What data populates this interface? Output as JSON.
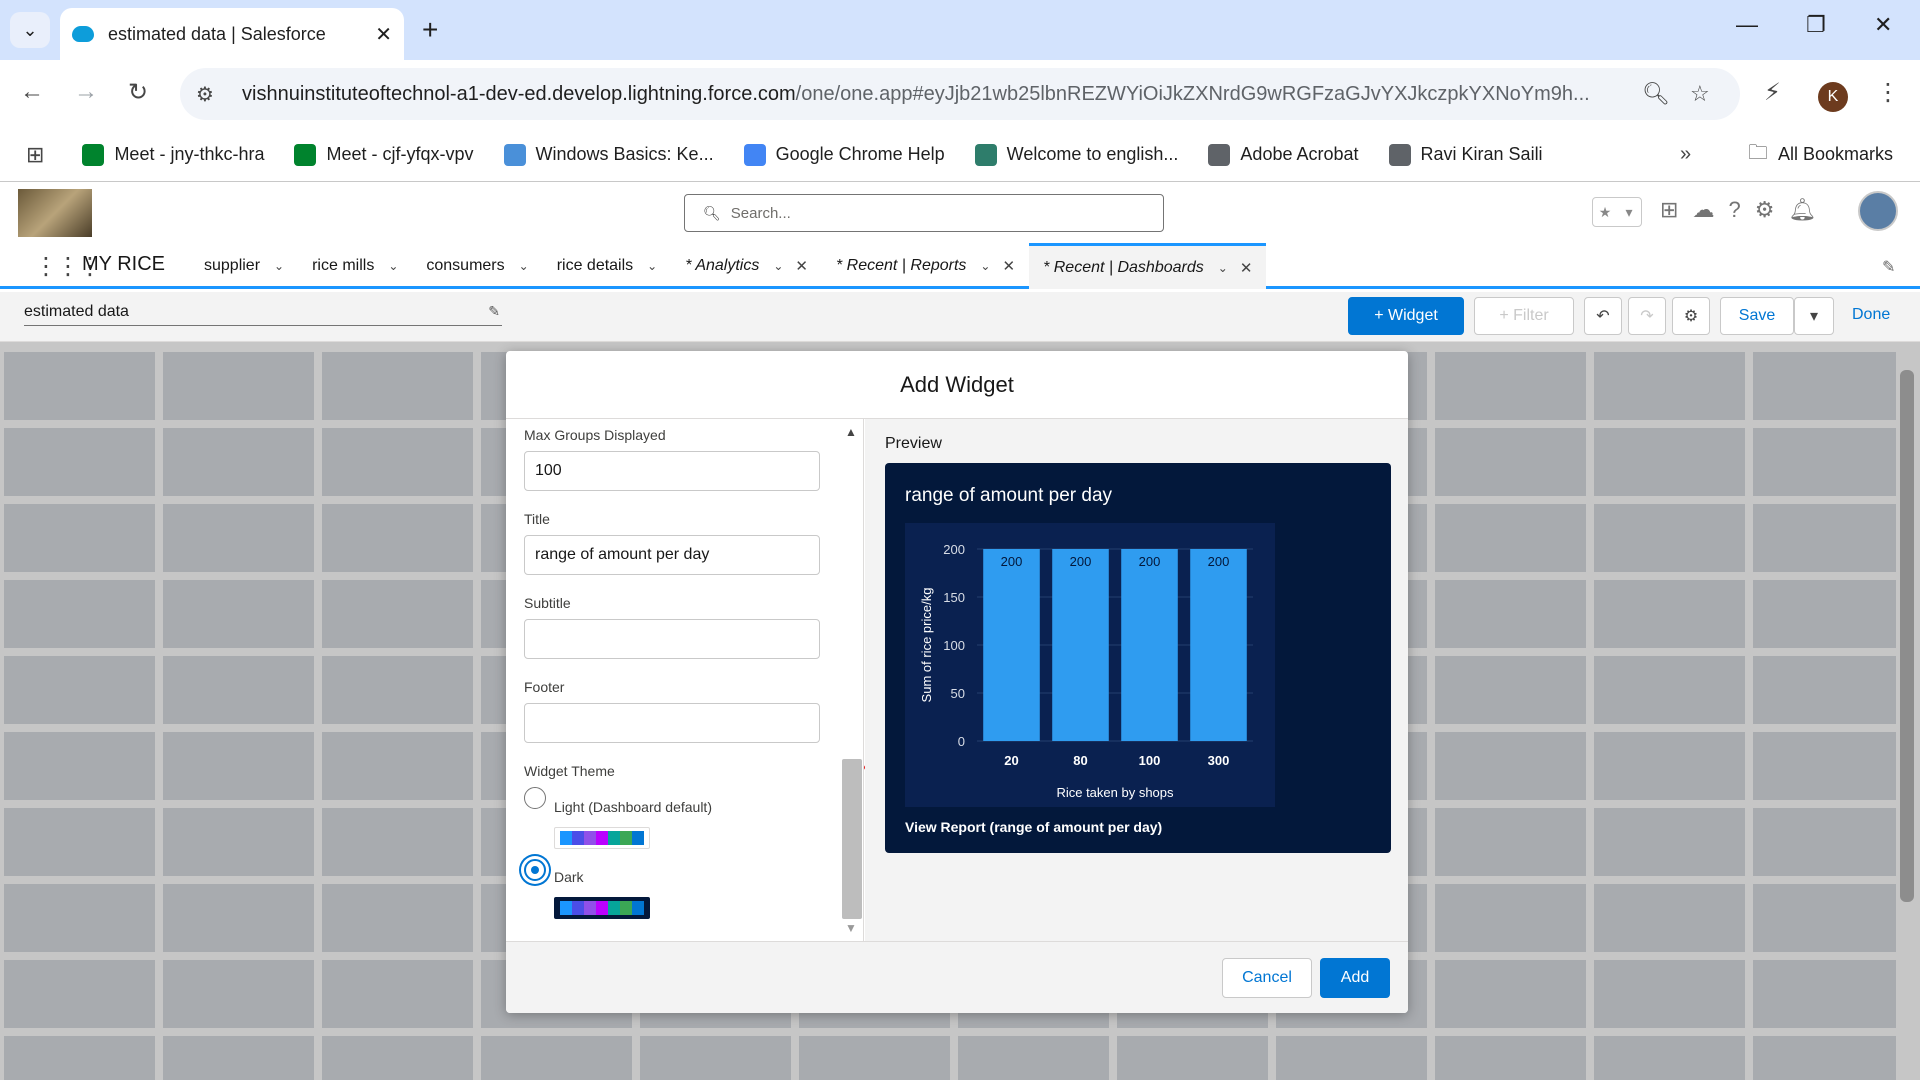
{
  "browser": {
    "tab_title": "estimated data | Salesforce",
    "url_host": "vishnuinstituteoftechnol-a1-dev-ed.develop.lightning.force.com",
    "url_path": "/one/one.app#eyJjb21wb25lbnREZWYiOiJkZXNrdG9wRGFzaGJvYXJkczpkYXNoYm9h...",
    "profile_initial": "K",
    "bookmarks": [
      {
        "label": "Meet - jny-thkc-hra",
        "color": "#00832d",
        "icon": "meet-icon"
      },
      {
        "label": "Meet - cjf-yfqx-vpv",
        "color": "#00832d",
        "icon": "meet-icon"
      },
      {
        "label": "Windows Basics: Ke...",
        "color": "#4a90d9",
        "icon": "globe-icon"
      },
      {
        "label": "Google Chrome Help",
        "color": "#4285f4",
        "icon": "google-icon"
      },
      {
        "label": "Welcome to english...",
        "color": "#2e7d6b",
        "icon": "t20-icon"
      },
      {
        "label": "Adobe Acrobat",
        "color": "#5f6368",
        "icon": "globe-icon"
      },
      {
        "label": "Ravi Kiran Saili",
        "color": "#5f6368",
        "icon": "globe-icon"
      }
    ],
    "all_bookmarks": "All Bookmarks"
  },
  "sf": {
    "search_placeholder": "Search...",
    "app_name": "MY RICE",
    "nav": [
      {
        "label": "supplier",
        "italic": false,
        "closable": false
      },
      {
        "label": "rice mills",
        "italic": false,
        "closable": false
      },
      {
        "label": "consumers",
        "italic": false,
        "closable": false
      },
      {
        "label": "rice details",
        "italic": false,
        "closable": false
      },
      {
        "label": "* Analytics",
        "italic": true,
        "closable": true
      },
      {
        "label": "* Recent | Reports",
        "italic": true,
        "closable": true
      },
      {
        "label": "* Recent | Dashboards",
        "italic": true,
        "closable": true,
        "active": true
      }
    ],
    "dashboard_name": "estimated data",
    "buttons": {
      "widget": "+ Widget",
      "filter": "+ Filter",
      "save": "Save",
      "done": "Done"
    }
  },
  "modal": {
    "title": "Add Widget",
    "fields": {
      "max_groups_label": "Max Groups Displayed",
      "max_groups_value": "100",
      "title_label": "Title",
      "title_value": "range of amount per day",
      "subtitle_label": "Subtitle",
      "subtitle_value": "",
      "footer_label": "Footer",
      "footer_value": ""
    },
    "theme": {
      "label": "Widget Theme",
      "light_label": "Light (Dashboard default)",
      "dark_label": "Dark",
      "selected": "Dark",
      "palette": [
        "#1b96ff",
        "#4b4ee8",
        "#9050e9",
        "#ba01ff",
        "#06a59a",
        "#3ba755",
        "#0176d3"
      ]
    },
    "preview_label": "Preview",
    "view_report": "View Report (range of amount per day)",
    "cancel": "Cancel",
    "add": "Add"
  },
  "chart_data": {
    "type": "bar",
    "title": "range of amount per day",
    "categories": [
      "20",
      "80",
      "100",
      "300"
    ],
    "values": [
      200,
      200,
      200,
      200
    ],
    "xlabel": "Rice taken by shops",
    "ylabel": "Sum of rice price/kg",
    "yticks": [
      0,
      50,
      100,
      150,
      200
    ],
    "ylim": [
      0,
      200
    ],
    "bar_color": "#2f9cf0",
    "data_labels": true
  }
}
